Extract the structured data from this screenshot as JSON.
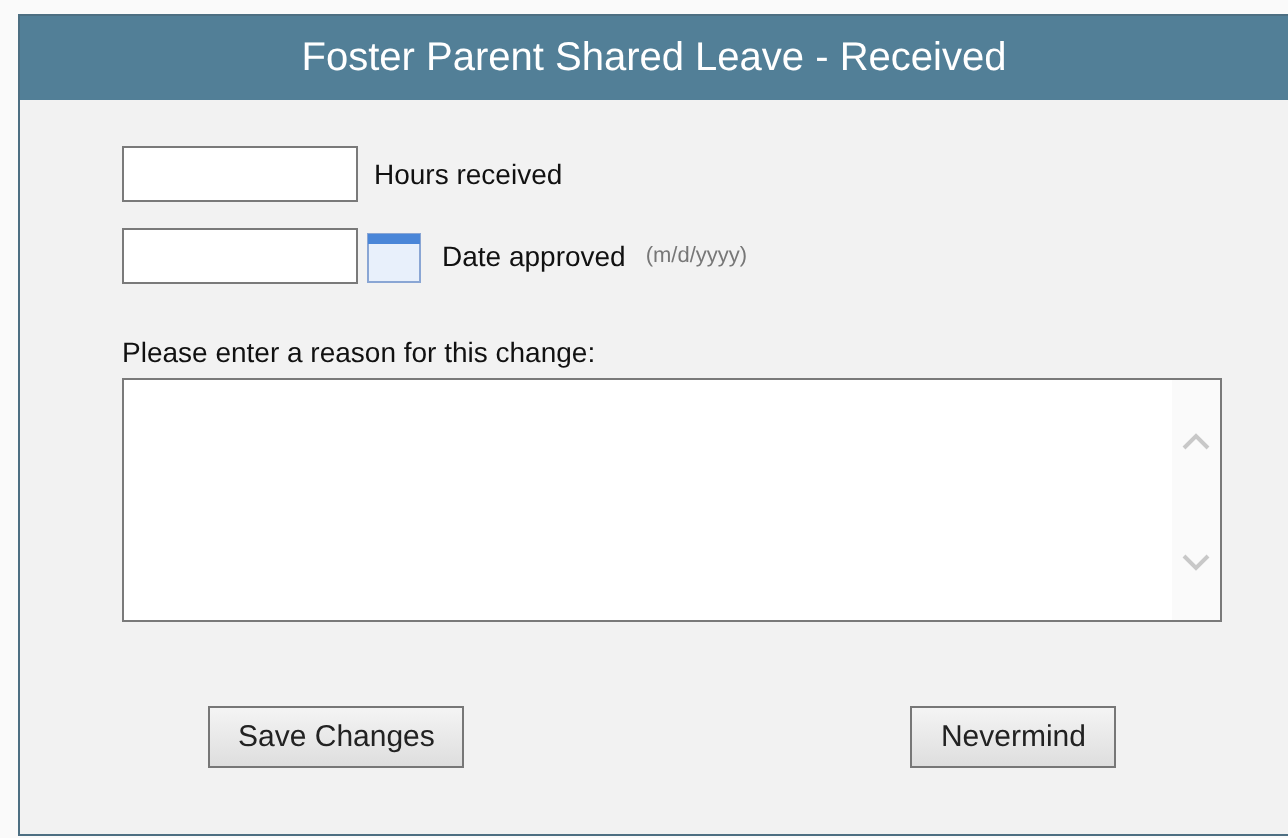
{
  "dialog": {
    "title": "Foster Parent Shared Leave - Received",
    "fields": [
      {
        "kind": "text",
        "label": "Hours received"
      },
      {
        "kind": "date",
        "label": "Date approved",
        "hint": "(m/d/yyyy)"
      }
    ],
    "reason": {
      "label": "Please enter a reason for this change:"
    },
    "buttons": [
      "Save Changes",
      "Nevermind"
    ]
  }
}
